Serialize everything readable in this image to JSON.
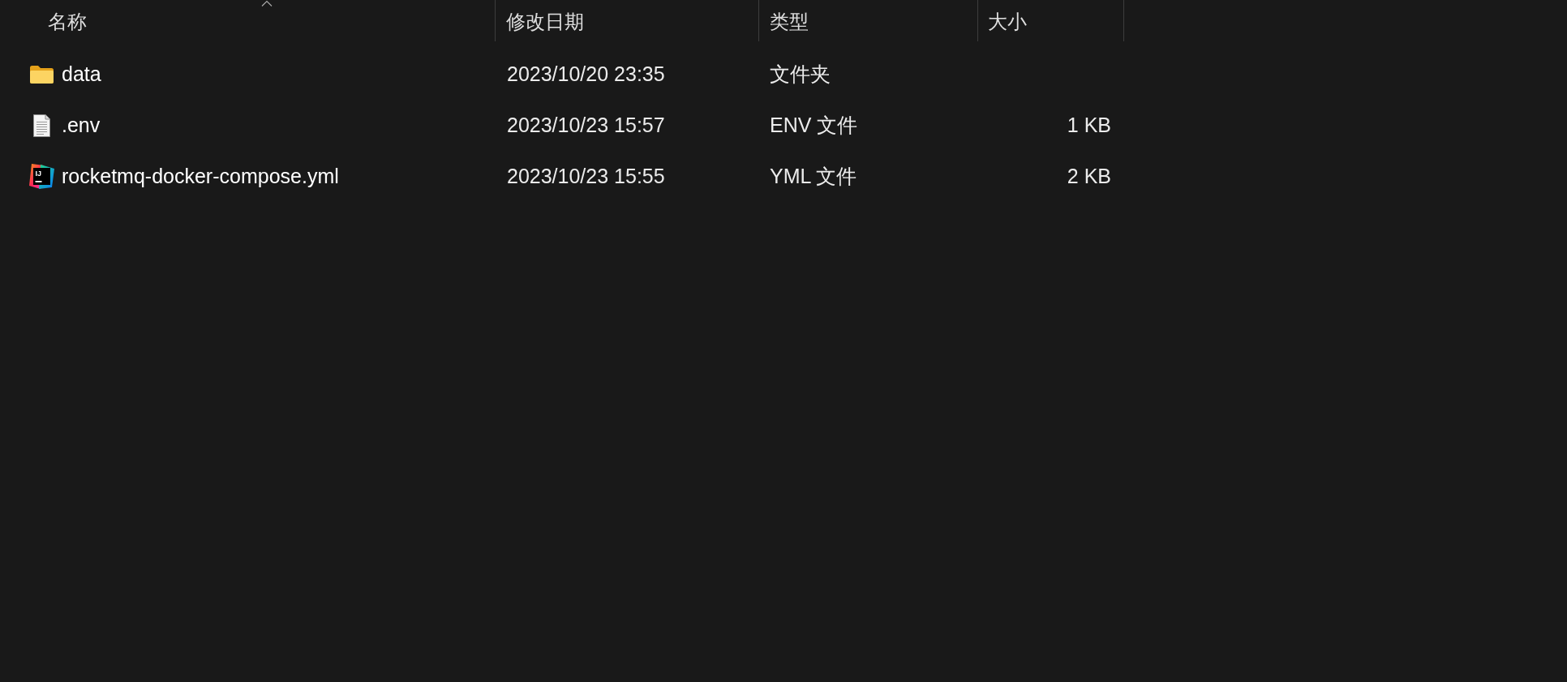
{
  "columns": [
    {
      "label": "名称",
      "sorted": true
    },
    {
      "label": "修改日期",
      "sorted": false
    },
    {
      "label": "类型",
      "sorted": false
    },
    {
      "label": "大小",
      "sorted": false
    }
  ],
  "files": [
    {
      "kind": "folder",
      "name": "data",
      "modified": "2023/10/20 23:35",
      "type": "文件夹"
    },
    {
      "kind": "document",
      "name": ".env",
      "modified": "2023/10/23 15:57",
      "type": "ENV 文件",
      "size": "1 KB"
    },
    {
      "kind": "ide",
      "logo_text": "IJ",
      "name": "rocketmq-docker-compose.yml",
      "modified": "2023/10/23 15:55",
      "type": "YML 文件",
      "size": "2 KB"
    }
  ]
}
